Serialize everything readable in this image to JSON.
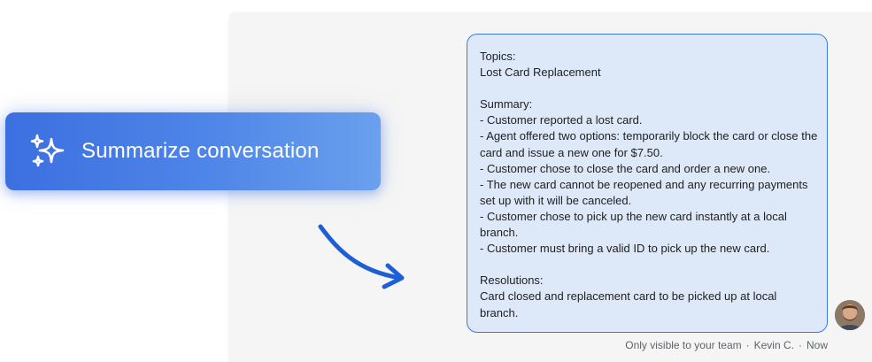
{
  "action_button": {
    "label": "Summarize conversation",
    "icon": "sparkle-icon"
  },
  "summary_message": {
    "lines": [
      "Topics:",
      "Lost Card Replacement",
      "",
      "Summary:",
      "- Customer reported a lost card.",
      "- Agent offered two options: temporarily block the card or close the card and issue a new one for $7.50.",
      "- Customer chose to close the card and order a new one.",
      "- The new card cannot be reopened and any recurring payments set up with it will be canceled.",
      "- Customer chose to pick up the new card instantly at a local branch.",
      "- Customer must bring a valid ID to pick up the new card.",
      "",
      "Resolutions:",
      "Card closed and replacement card to be picked up at local branch."
    ]
  },
  "message_meta": {
    "visibility": "Only visible to your team",
    "separator": "·",
    "author": "Kevin C.",
    "time": "Now"
  },
  "colors": {
    "accent": "#3b7be0",
    "bubble_bg": "#dde8f9",
    "button_gradient_start": "#3c6fe0",
    "button_gradient_end": "#6aa0ee"
  }
}
